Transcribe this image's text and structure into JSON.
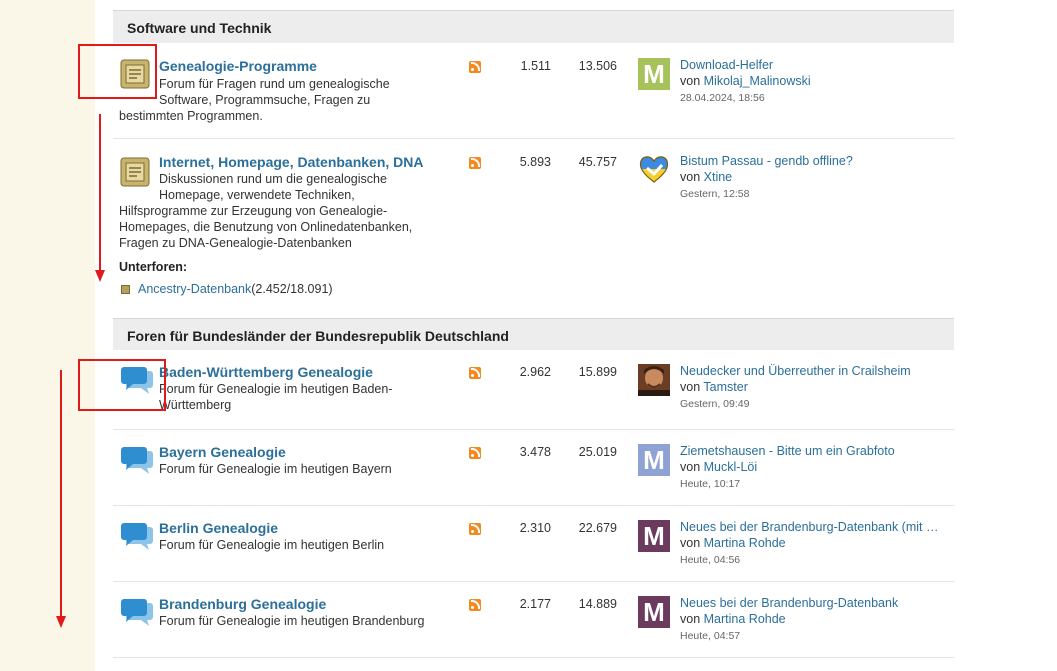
{
  "sections": [
    {
      "title": "Software und Technik",
      "forums": [
        {
          "name": "Genealogie-Programme",
          "desc_lines": [
            "Forum für Fragen rund um genealogische",
            "Software, Programmsuche, Fragen zu",
            "bestimmten Programmen."
          ],
          "topics": "1.511",
          "posts": "13.506",
          "last_title": "Download-Helfer",
          "last_by": "von",
          "last_user": "Mikolaj_Malinowski",
          "last_date": "28.04.2024, 18:56",
          "avatar_letter": "M",
          "avatar_color": "#a7c25b"
        },
        {
          "name": "Internet, Homepage, Datenbanken, DNA",
          "desc_lines": [
            "Diskussionen rund um die genealogische",
            "Homepage, verwendete Techniken,",
            "Hilfsprogramme zur Erzeugung von Genealogie-",
            "Homepages, die Benutzung von Onlinedatenbanken,",
            "Fragen zu DNA-Genealogie-Datenbanken"
          ],
          "topics": "5.893",
          "posts": "45.757",
          "last_title": "Bistum Passau - gendb offline?",
          "last_by": "von",
          "last_user": "Xtine",
          "last_date": "Gestern, 12:58",
          "avatar_icon": "ukraine-heart-icon",
          "subforums_label": "Unterforen:",
          "subforum_name": "Ancestry-Datenbank",
          "subforum_count": "(2.452/18.091)"
        }
      ]
    },
    {
      "title": "Foren für Bundesländer der Bundesrepublik Deutschland",
      "forums": [
        {
          "name": "Baden-Württemberg Genealogie",
          "desc_lines": [
            "Forum für Genealogie im heutigen Baden-",
            "Württemberg"
          ],
          "topics": "2.962",
          "posts": "15.899",
          "last_title": "Neudecker und Überreuther in Crailsheim",
          "last_by": "von",
          "last_user": "Tamster",
          "last_date": "Gestern, 09:49",
          "avatar_icon": "user-photo"
        },
        {
          "name": "Bayern Genealogie",
          "desc_lines": [
            "Forum für Genealogie im heutigen Bayern"
          ],
          "topics": "3.478",
          "posts": "25.019",
          "last_title": "Ziemetshausen - Bitte um ein Grabfoto",
          "last_by": "von",
          "last_user": "Muckl-Löi",
          "last_date": "Heute, 10:17",
          "avatar_letter": "M",
          "avatar_color": "#8ea3d4"
        },
        {
          "name": "Berlin Genealogie",
          "desc_lines": [
            "Forum für Genealogie im heutigen Berlin"
          ],
          "topics": "2.310",
          "posts": "22.679",
          "last_title": "Neues bei der Brandenburg-Datenbank (mit …",
          "last_by": "von",
          "last_user": "Martina Rohde",
          "last_date": "Heute, 04:56",
          "avatar_letter": "M",
          "avatar_color": "#6b3a5c"
        },
        {
          "name": "Brandenburg Genealogie",
          "desc_lines": [
            "Forum für Genealogie im heutigen Brandenburg"
          ],
          "topics": "2.177",
          "posts": "14.889",
          "last_title": "Neues bei der Brandenburg-Datenbank",
          "last_by": "von",
          "last_user": "Martina Rohde",
          "last_date": "Heute, 04:57",
          "avatar_letter": "M",
          "avatar_color": "#6b3a5c"
        }
      ]
    }
  ],
  "icons": {
    "forum_software": "folder-doc-icon",
    "forum_chat": "speech-bubbles-icon",
    "rss": "rss-icon",
    "annotation_color": "#e01a1a",
    "chat_icon_color": "#2f8ed0"
  }
}
